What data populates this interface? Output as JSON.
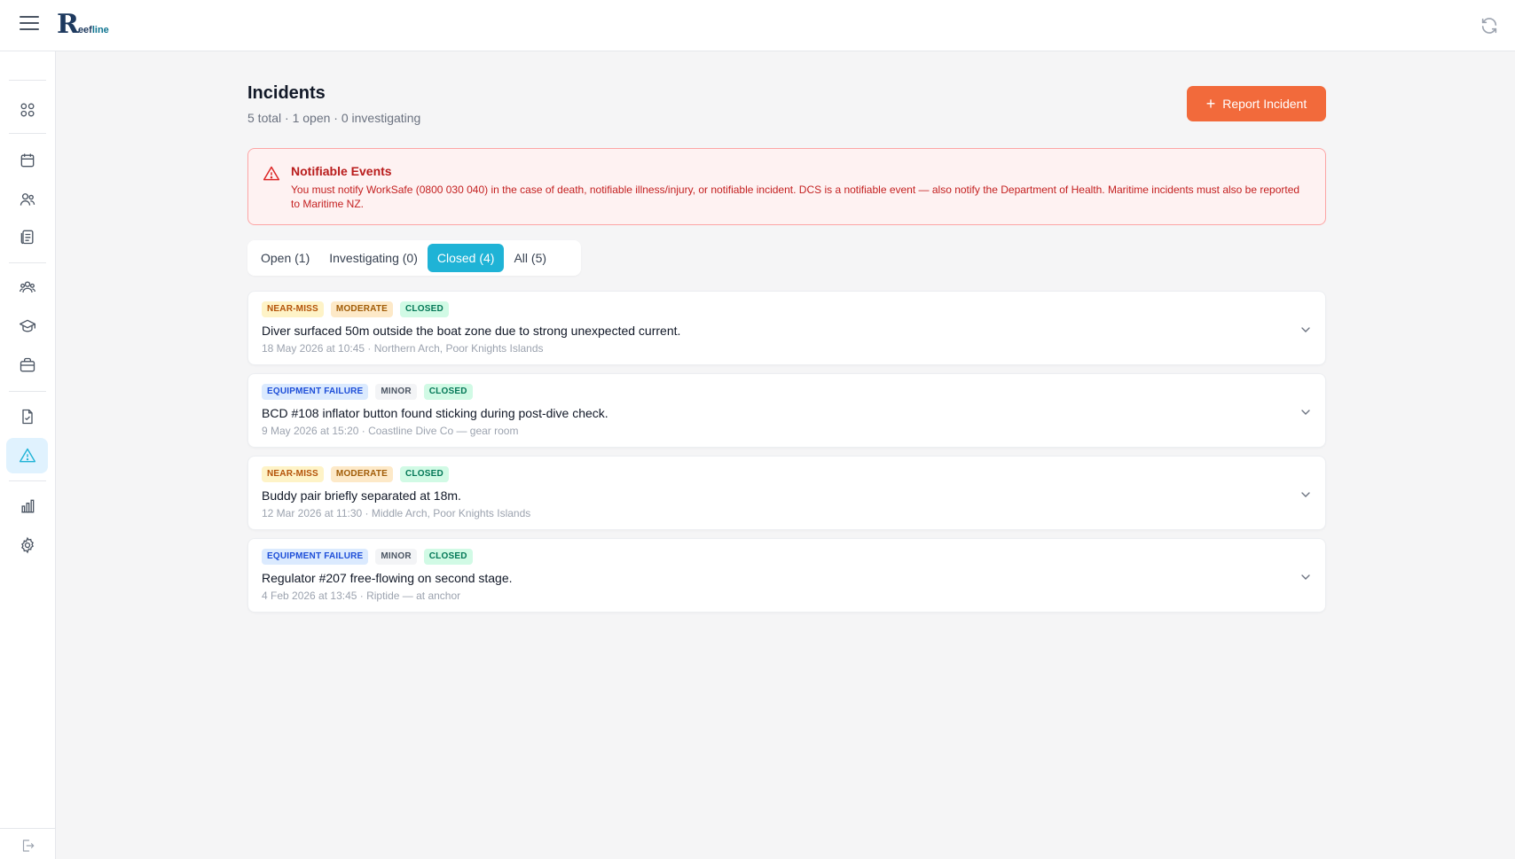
{
  "brand": {
    "mark": "R",
    "text_a": "eef",
    "text_b": "line"
  },
  "page": {
    "title": "Incidents",
    "subtitle": "5 total · 1 open · 0 investigating",
    "report_button": "Report Incident"
  },
  "alert": {
    "title": "Notifiable Events",
    "text": "You must notify WorkSafe (0800 030 040) in the case of death, notifiable illness/injury, or notifiable incident. DCS is a notifiable event — also notify the Department of Health. Maritime incidents must also be reported to Maritime NZ."
  },
  "tabs": [
    {
      "label": "Open (1)"
    },
    {
      "label": "Investigating (0)"
    },
    {
      "label": "Closed (4)"
    },
    {
      "label": "All (5)"
    }
  ],
  "incidents": [
    {
      "type": "NEAR-MISS",
      "severity": "MODERATE",
      "status": "CLOSED",
      "title": "Diver surfaced 50m outside the boat zone due to strong unexpected current.",
      "meta": "18 May 2026 at 10:45 · Northern Arch, Poor Knights Islands"
    },
    {
      "type": "EQUIPMENT FAILURE",
      "severity": "MINOR",
      "status": "CLOSED",
      "title": "BCD #108 inflator button found sticking during post-dive check.",
      "meta": "9 May 2026 at 15:20 · Coastline Dive Co — gear room"
    },
    {
      "type": "NEAR-MISS",
      "severity": "MODERATE",
      "status": "CLOSED",
      "title": "Buddy pair briefly separated at 18m.",
      "meta": "12 Mar 2026 at 11:30 · Middle Arch, Poor Knights Islands"
    },
    {
      "type": "EQUIPMENT FAILURE",
      "severity": "MINOR",
      "status": "CLOSED",
      "title": "Regulator #207 free-flowing on second stage.",
      "meta": "4 Feb 2026 at 13:45 · Riptide — at anchor"
    }
  ],
  "colors": {
    "accent": "#1fb3d6",
    "cta": "#f26a3b",
    "alert": "#b91c1c"
  }
}
